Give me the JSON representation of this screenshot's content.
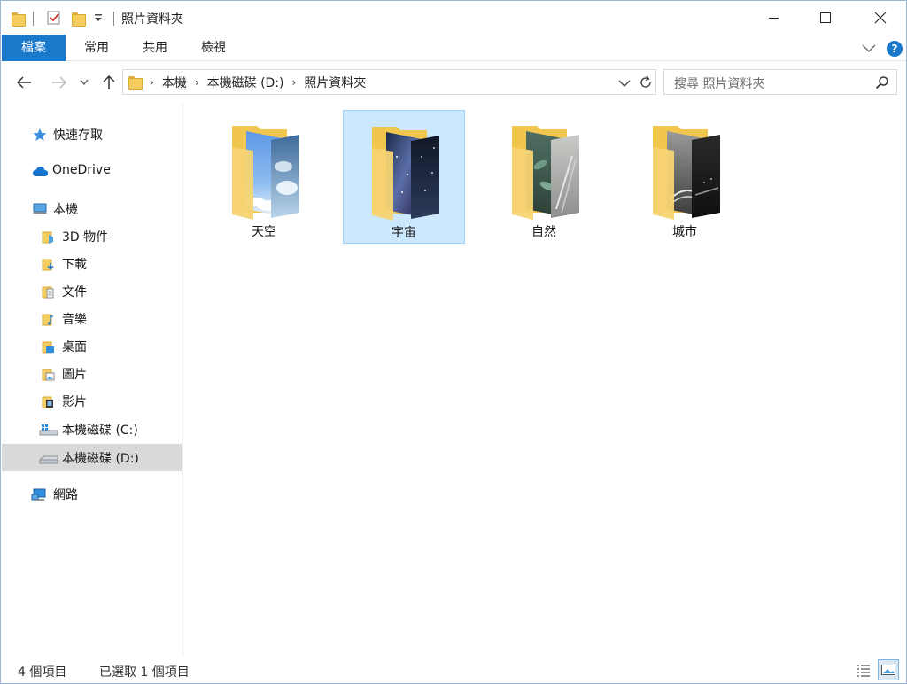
{
  "window": {
    "title": "照片資料夾"
  },
  "ribbon": {
    "tabs": [
      "檔案",
      "常用",
      "共用",
      "檢視"
    ],
    "help_label": "?"
  },
  "address": {
    "crumbs": [
      "本機",
      "本機磁碟 (D:)",
      "照片資料夾"
    ]
  },
  "search": {
    "placeholder": "搜尋 照片資料夾"
  },
  "nav": {
    "quick_access": "快速存取",
    "onedrive": "OneDrive",
    "this_pc": "本機",
    "items": [
      {
        "label": "3D 物件",
        "icon": "3d-objects-icon"
      },
      {
        "label": "下載",
        "icon": "downloads-icon"
      },
      {
        "label": "文件",
        "icon": "documents-icon"
      },
      {
        "label": "音樂",
        "icon": "music-icon"
      },
      {
        "label": "桌面",
        "icon": "desktop-icon"
      },
      {
        "label": "圖片",
        "icon": "pictures-icon"
      },
      {
        "label": "影片",
        "icon": "videos-icon"
      },
      {
        "label": "本機磁碟 (C:)",
        "icon": "drive-c-icon"
      },
      {
        "label": "本機磁碟 (D:)",
        "icon": "drive-d-icon",
        "selected": true
      }
    ],
    "network": "網路"
  },
  "folders": [
    {
      "name": "天空",
      "theme": "sky",
      "selected": false
    },
    {
      "name": "宇宙",
      "theme": "space",
      "selected": true
    },
    {
      "name": "自然",
      "theme": "nature",
      "selected": false
    },
    {
      "name": "城市",
      "theme": "city",
      "selected": false
    }
  ],
  "status": {
    "count": "4 個項目",
    "selected": "已選取 1 個項目"
  },
  "colors": {
    "accent": "#1979ca",
    "selection_bg": "#cce8ff",
    "selection_border": "#99d1ff",
    "folder": "#f5cd5e"
  }
}
